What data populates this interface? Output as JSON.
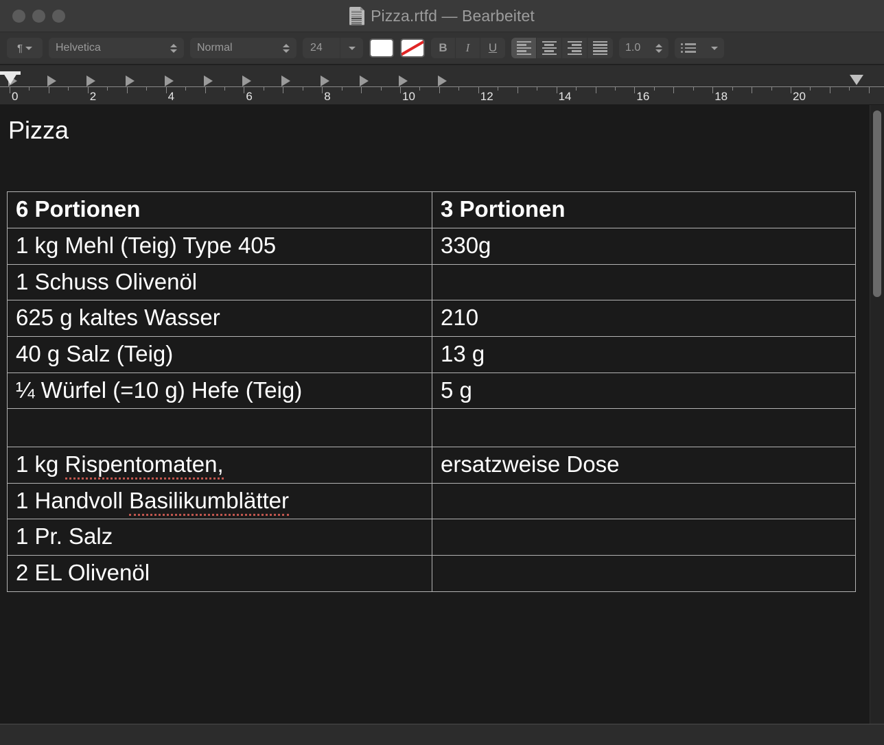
{
  "window": {
    "title": "Pizza.rtfd — Bearbeitet",
    "traffic_lights": [
      "close",
      "minimize",
      "zoom"
    ]
  },
  "toolbar": {
    "paragraph_style_icon": "pilcrow-icon",
    "font_family": "Helvetica",
    "font_style": "Normal",
    "font_size": "24",
    "text_color": "#ffffff",
    "background_color_none": "#ffffff",
    "bold_label": "B",
    "italic_label": "I",
    "underline_label": "U",
    "alignment_selected": "left",
    "alignments": [
      "left",
      "center",
      "right",
      "justify"
    ],
    "line_spacing": "1.0",
    "list_style_icon": "bullet-list-icon"
  },
  "ruler": {
    "numbers": [
      "0",
      "2",
      "4",
      "6",
      "8",
      "10",
      "12",
      "14",
      "16",
      "18",
      "20"
    ],
    "tab_stops": [
      "0",
      "1",
      "2",
      "3",
      "4",
      "5",
      "6",
      "7",
      "8",
      "9",
      "10",
      "11"
    ],
    "left_indent": "0",
    "right_indent": "21.5"
  },
  "document": {
    "heading": "Pizza",
    "table": {
      "headers": [
        "6 Portionen",
        "3 Portionen"
      ],
      "rows": [
        {
          "left": "1 kg Mehl (Teig) Type 405",
          "right": "330g"
        },
        {
          "left": "1 Schuss Olivenöl",
          "right": ""
        },
        {
          "left": "625 g kaltes Wasser",
          "right": "210"
        },
        {
          "left": "40 g Salz (Teig)",
          "right": "13 g"
        },
        {
          "left": "¼ Würfel (=10 g)  Hefe (Teig)",
          "right": "5 g"
        },
        {
          "left": "",
          "right": ""
        },
        {
          "left_prefix": "1 kg ",
          "left_misspelled": "Rispentomaten,",
          "left": "1 kg Rispentomaten,",
          "right": "ersatzweise Dose"
        },
        {
          "left_prefix": "1 Handvoll ",
          "left_misspelled": "Basilikumblätter",
          "left": "1 Handvoll Basilikumblätter",
          "right": ""
        },
        {
          "left": "1 Pr. Salz",
          "right": ""
        },
        {
          "left": "2 EL Olivenöl",
          "right": ""
        }
      ]
    }
  },
  "colors": {
    "page_background": "#1a1a1a",
    "text": "#ffffff",
    "table_border": "#b4b4b4",
    "spellcheck_underline": "#c0564e",
    "titlebar": "#3a3a3a",
    "toolbar": "#333333"
  }
}
